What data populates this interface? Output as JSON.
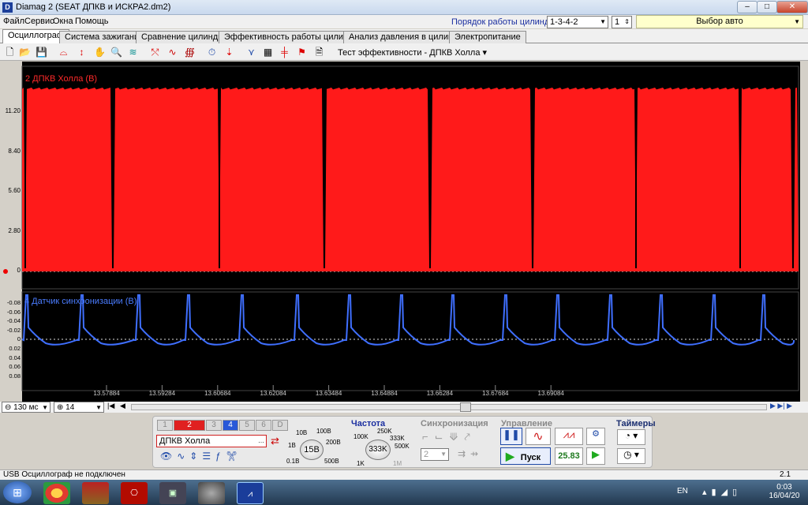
{
  "window": {
    "title": "Diamag 2 (SEAT ДПКВ и ИСКРА2.dm2)",
    "min": "–",
    "max": "□",
    "close": "✕"
  },
  "menu": [
    "Файл",
    "Сервис",
    "Окна",
    "Помощь"
  ],
  "header": {
    "cyl_order_label": "Порядок работы цилиндров",
    "cyl_order_value": "1-3-4-2",
    "cyl_num": "1",
    "auto_select": "Выбор авто"
  },
  "tabs": [
    "Осциллограф",
    "Система зажигания",
    "Сравнение цилиндров",
    "Эффективность работы цилиндров",
    "Анализ давления в цилиндре",
    "Электропитание"
  ],
  "toolbar": {
    "test_label": "Тест эффективности - ДПКВ Холла ▾"
  },
  "channels": {
    "ch2": {
      "label": "2 ДПКВ Холла (В)",
      "color": "#ff1a1a",
      "ticks": [
        "11.20",
        "8.40",
        "5.60",
        "2.80",
        "0"
      ]
    },
    "ch4": {
      "label": "4 Датчик синхронизации (В)",
      "color": "#3f6fff",
      "ticks": [
        "-0.08",
        "-0.06",
        "-0.04",
        "-0.02",
        "0",
        "0.02",
        "0.04",
        "0.06",
        "0.08"
      ]
    }
  },
  "time_ticks": [
    "13.57884",
    "13.59284",
    "13.60684",
    "13.62084",
    "13.63484",
    "13.64884",
    "13.66284",
    "13.67684",
    "13.69084"
  ],
  "bottom_bar": {
    "timebase": "130 мс",
    "count": "14"
  },
  "controls": {
    "channel_buttons": [
      "1",
      "2",
      "3",
      "4",
      "5",
      "6",
      "D"
    ],
    "sensor_name": "ДПКВ Холла",
    "range_labels": [
      "10В",
      "100В",
      "1В",
      "200В",
      "0.1В",
      "500В"
    ],
    "range_value": "15В",
    "freq_title": "Частота",
    "freq_labels": [
      "250K",
      "100K",
      "333K",
      "500K",
      "1K",
      "1M"
    ],
    "freq_value": "333K",
    "sync_title": "Синхронизация",
    "sync_value": "2",
    "control_title": "Управление",
    "start_label": "Пуск",
    "rate_value": "25.83",
    "timers_title": "Таймеры"
  },
  "status": {
    "left": "USB Осциллограф не подключен",
    "right": "2.1"
  },
  "taskbar": {
    "lang": "EN",
    "time": "0:03",
    "date": "16/04/20"
  }
}
